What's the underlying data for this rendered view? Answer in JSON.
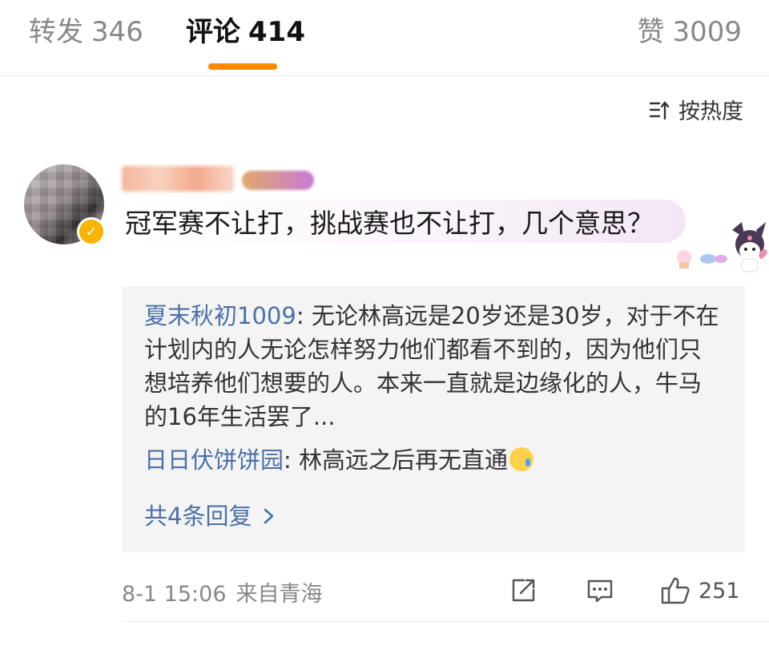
{
  "tabs": [
    {
      "label": "转发",
      "count": "346"
    },
    {
      "label": "评论",
      "count": "414",
      "active": true
    },
    {
      "label": "赞",
      "count": "3009"
    }
  ],
  "accent_color": "#ff8a00",
  "link_color": "#4a70a8",
  "sort": {
    "label": "按热度",
    "icon": "sort-icon"
  },
  "comment": {
    "text": "冠军赛不让打，挑战赛也不让打，几个意思？",
    "time": "8-1 15:06",
    "source": "来自青海",
    "likes": "251",
    "replies": [
      {
        "author": "夏末秋初1009",
        "separator": ": ",
        "text": "无论林高远是20岁还是30岁，对于不在计划内的人无论怎样努力他们都看不到的，因为他们只想培养他们想要的人。本来一直就是边缘化的人，牛马的16年生活罢了..."
      },
      {
        "author": "日日伏饼饼园",
        "separator": ": ",
        "text": "林高远之后再无直通"
      }
    ],
    "more_replies": "共4条回复"
  }
}
